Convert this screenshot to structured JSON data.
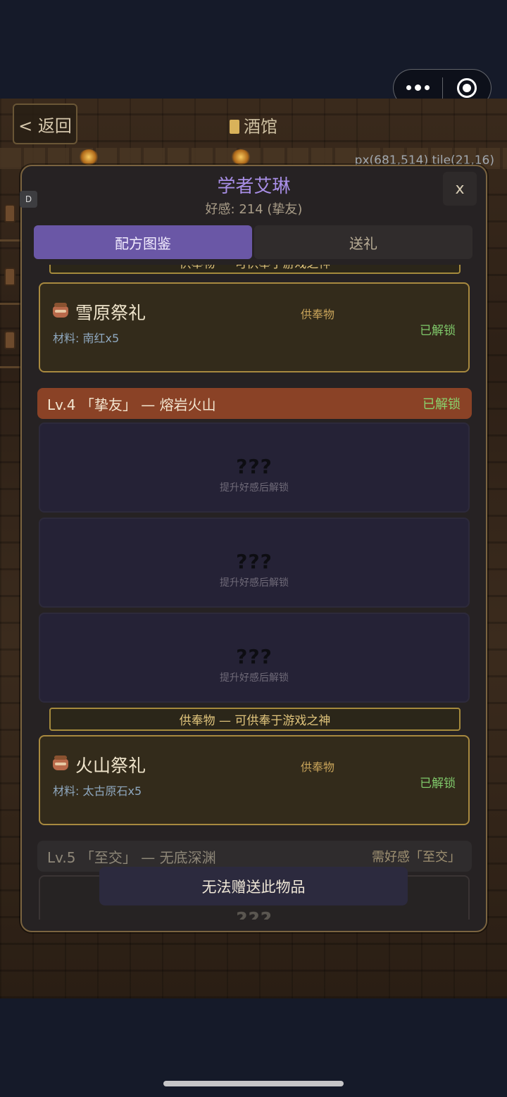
{
  "header": {
    "back_label": "< 返回",
    "title": "酒馆",
    "coords": "px(681,514) tile(21,16)"
  },
  "debug_badge": "D",
  "npc": {
    "name": "学者艾琳",
    "affinity": "好感: 214 (挚友)",
    "close_label": "x"
  },
  "tabs": [
    {
      "label": "配方图鉴",
      "active": true
    },
    {
      "label": "送礼",
      "active": false
    }
  ],
  "offering_banner": "供奉物 — 可供奉于游戏之神",
  "recipes": [
    {
      "name": "雪原祭礼",
      "tag": "供奉物",
      "material": "材料: 南红x5",
      "status": "已解锁"
    },
    {
      "name": "火山祭礼",
      "tag": "供奉物",
      "material": "材料: 太古原石x5",
      "status": "已解锁"
    }
  ],
  "levels": [
    {
      "label": "Lv.4 「挚友」 — 熔岩火山",
      "status": "已解锁"
    },
    {
      "label": "Lv.5 「至交」 — 无底深渊",
      "status": "需好感「至交」"
    }
  ],
  "locked": {
    "placeholder": "???",
    "hint": "提升好感后解锁"
  },
  "toast": "无法赠送此物品",
  "colors": {
    "accent": "#6a57a6",
    "unlocked": "#7fc86a",
    "level_bar": "#8a4226",
    "card_border": "#a8893f"
  }
}
